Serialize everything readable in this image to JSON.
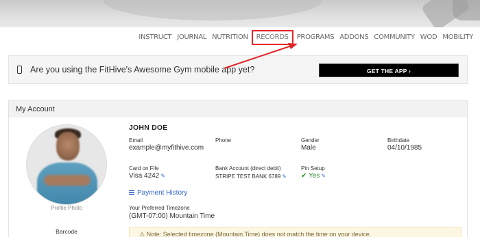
{
  "nav": {
    "items": [
      "INSTRUCT",
      "JOURNAL",
      "NUTRITION",
      "RECORDS",
      "PROGRAMS",
      "ADDONS",
      "COMMUNITY",
      "WOD",
      "MOBILITY"
    ],
    "highlighted": "RECORDS"
  },
  "banner": {
    "text": "Are you using the FitHive's Awesome Gym mobile app yet?",
    "cta": "GET THE APP ›",
    "icon": "mobile-phone-icon"
  },
  "account": {
    "title": "My Account",
    "name": "JOHN DOE",
    "photo_label": "Profile Photo",
    "barcode_label": "Barcode",
    "email_label": "Email",
    "email": "example@myfithive.com",
    "phone_label": "Phone",
    "phone": "",
    "gender_label": "Gender",
    "gender": "Male",
    "birthdate_label": "Birthdate",
    "birthdate": "04/10/1985",
    "card_label": "Card on File",
    "card": "Visa 4242",
    "bank_label": "Bank Account (direct debit)",
    "bank": "STRIPE TEST BANK 6789",
    "pin_label": "Pin Setup",
    "pin": "Yes",
    "payment_history": "Payment History",
    "timezone_label": "Your Preferred Timezone",
    "timezone": "(GMT-07:00) Mountain Time",
    "note": "Note: Selected timezone (Mountain Time) does not match the time on your device."
  },
  "colors": {
    "highlight": "#e0262a",
    "link": "#3366cc",
    "success": "#2f8a2f"
  }
}
